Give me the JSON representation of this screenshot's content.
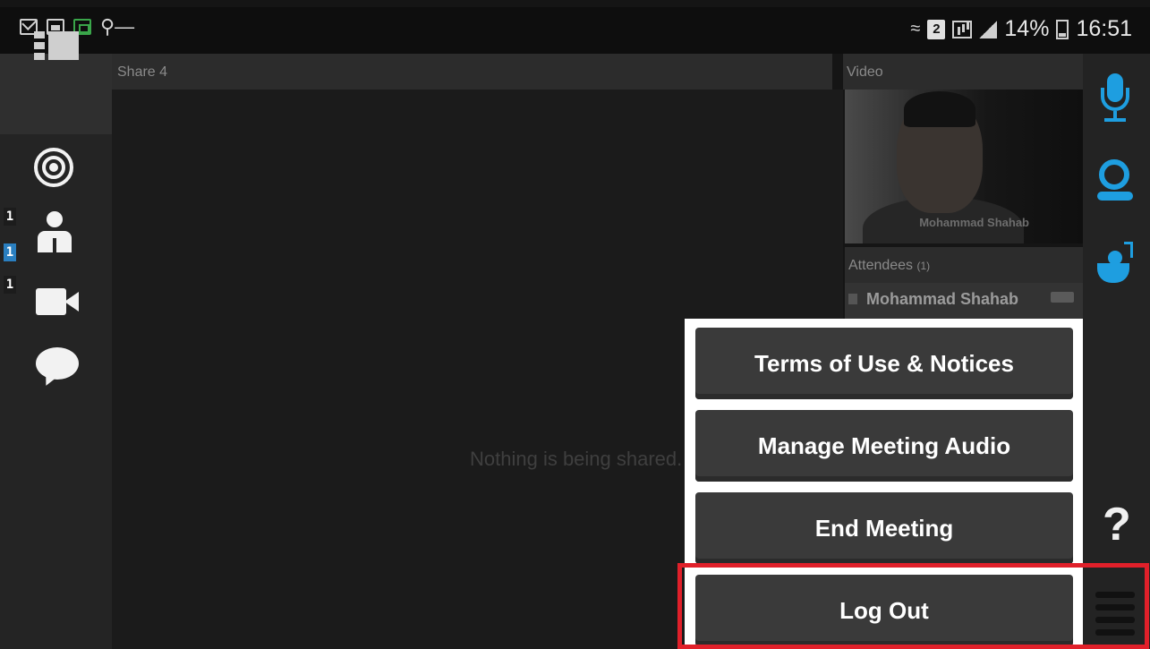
{
  "status_bar": {
    "left_icons": [
      "mail-icon",
      "gallery-icon",
      "excel-icon",
      "key-icon"
    ],
    "sim_label": "2",
    "battery": "14%",
    "time": "16:51"
  },
  "sidebar": {
    "badges": [
      "1",
      "1",
      "1"
    ]
  },
  "share": {
    "title": "Share 4",
    "empty_message": "Nothing is being shared."
  },
  "video": {
    "title": "Video",
    "participant_name": "Mohammad Shahab"
  },
  "attendees": {
    "title": "Attendees",
    "count": "(1)",
    "list": [
      {
        "name": "Mohammad Shahab"
      }
    ]
  },
  "menu": {
    "items": [
      {
        "label": "Terms of Use & Notices"
      },
      {
        "label": "Manage Meeting Audio"
      },
      {
        "label": "End Meeting"
      },
      {
        "label": "Log Out"
      }
    ]
  },
  "toolbar": {
    "help_label": "?"
  },
  "colors": {
    "accent": "#1e9ee0",
    "highlight": "#e0202a"
  }
}
